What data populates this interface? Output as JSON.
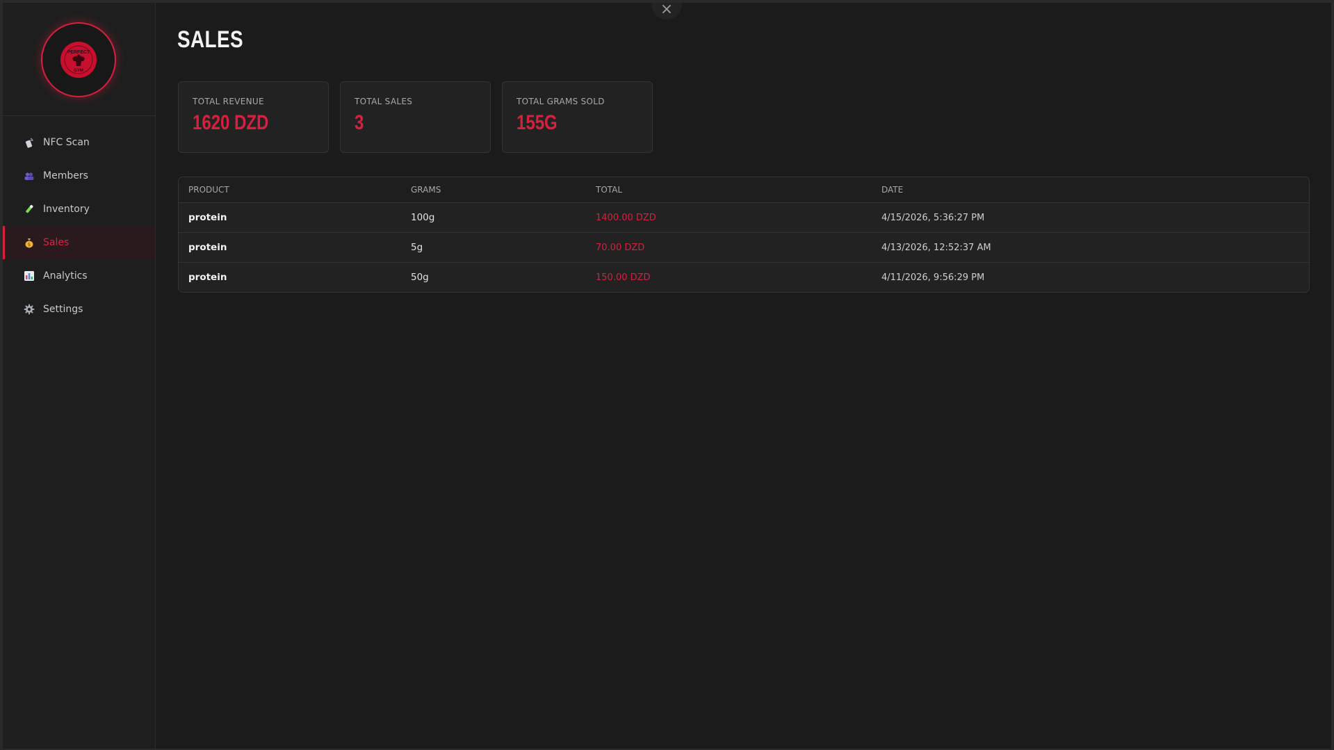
{
  "window": {
    "close_label": "×"
  },
  "sidebar": {
    "logo": {
      "top_text": "PERFECT",
      "bottom_text": "GYM"
    },
    "items": [
      {
        "label": "NFC Scan",
        "icon": "nfc-scan-icon"
      },
      {
        "label": "Members",
        "icon": "members-icon"
      },
      {
        "label": "Inventory",
        "icon": "inventory-icon"
      },
      {
        "label": "Sales",
        "icon": "sales-icon",
        "active": true
      },
      {
        "label": "Analytics",
        "icon": "analytics-icon"
      },
      {
        "label": "Settings",
        "icon": "settings-icon"
      }
    ]
  },
  "main": {
    "title": "SALES",
    "stats": [
      {
        "label": "TOTAL REVENUE",
        "value": "1620 DZD"
      },
      {
        "label": "TOTAL SALES",
        "value": "3"
      },
      {
        "label": "TOTAL GRAMS SOLD",
        "value": "155G"
      }
    ],
    "table": {
      "columns": [
        "PRODUCT",
        "GRAMS",
        "TOTAL",
        "DATE"
      ],
      "rows": [
        {
          "product": "protein",
          "grams": "100g",
          "total": "1400.00 DZD",
          "date": "4/15/2026, 5:36:27 PM"
        },
        {
          "product": "protein",
          "grams": "5g",
          "total": "70.00 DZD",
          "date": "4/13/2026, 12:52:37 AM"
        },
        {
          "product": "protein",
          "grams": "50g",
          "total": "150.00 DZD",
          "date": "4/11/2026, 9:56:29 PM"
        }
      ]
    }
  },
  "colors": {
    "accent": "#d6203f",
    "background": "#1b1b1b",
    "sidebar": "#1e1e1e",
    "card": "#222222"
  }
}
